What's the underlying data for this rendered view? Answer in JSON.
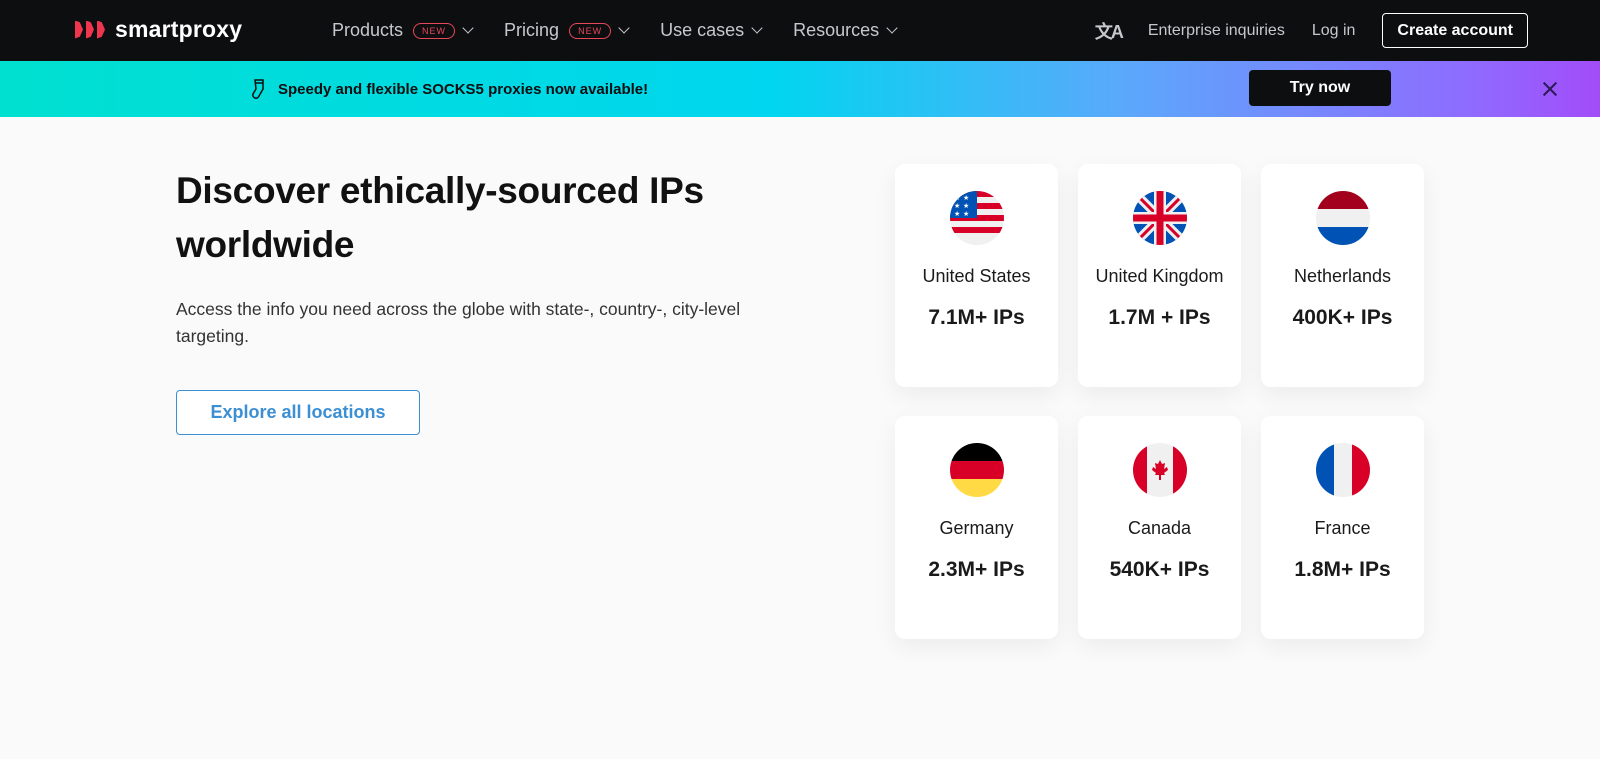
{
  "nav": {
    "brand": "smartproxy",
    "menu": [
      {
        "label": "Products",
        "badge": "NEW"
      },
      {
        "label": "Pricing",
        "badge": "NEW"
      },
      {
        "label": "Use cases"
      },
      {
        "label": "Resources"
      }
    ],
    "translate_icon": "translate-icon",
    "enterprise": "Enterprise inquiries",
    "login": "Log in",
    "create_account": "Create account"
  },
  "banner": {
    "icon": "sock-icon",
    "text": "Speedy and flexible SOCKS5 proxies now available!",
    "cta": "Try now",
    "close_icon": "close-icon"
  },
  "hero": {
    "title": "Discover ethically-sourced IPs worldwide",
    "description": "Access the info you need across the globe with state-, country-, city-level targeting.",
    "cta": "Explore all locations"
  },
  "locations": [
    {
      "country": "United States",
      "count": "7.1M+ IPs",
      "flag": "us-flag"
    },
    {
      "country": "United Kingdom",
      "count": "1.7M + IPs",
      "flag": "uk-flag"
    },
    {
      "country": "Netherlands",
      "count": "400K+ IPs",
      "flag": "nl-flag"
    },
    {
      "country": "Germany",
      "count": "2.3M+ IPs",
      "flag": "de-flag"
    },
    {
      "country": "Canada",
      "count": "540K+ IPs",
      "flag": "ca-flag"
    },
    {
      "country": "France",
      "count": "1.8M+ IPs",
      "flag": "fr-flag"
    }
  ],
  "colors": {
    "nav_bg": "#0d0e10",
    "brand_red": "#f0364f",
    "accent_blue": "#3d8fd4",
    "page_bg": "#fafafa"
  }
}
